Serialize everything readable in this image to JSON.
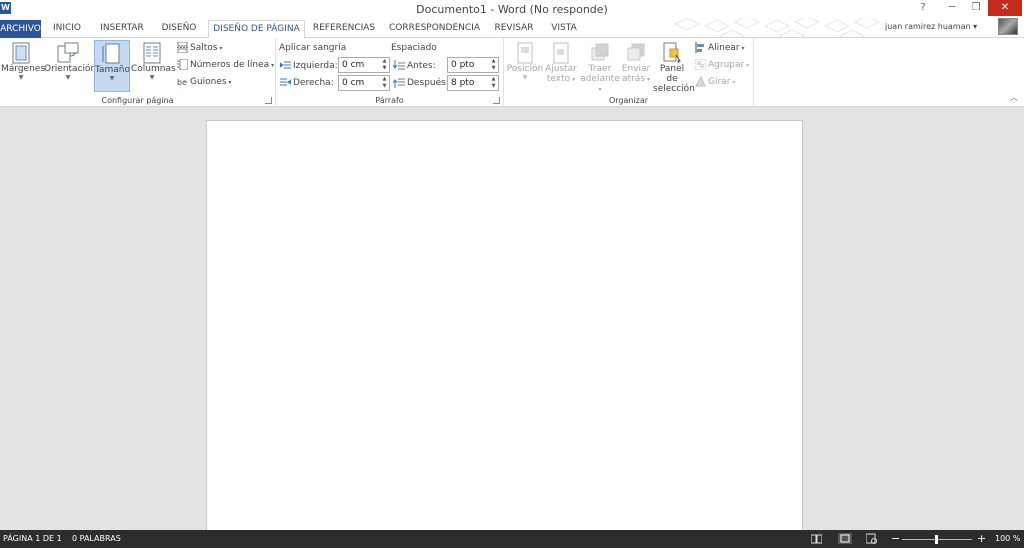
{
  "window": {
    "app_icon": "W",
    "title": "Documento1 - Word (No responde)",
    "help": "?",
    "minimize": "─",
    "restore": "❐",
    "close": "✕"
  },
  "tabs": {
    "file": "ARCHIVO",
    "items": [
      "INICIO",
      "INSERTAR",
      "DISEÑO",
      "DISEÑO DE PÁGINA",
      "REFERENCIAS",
      "CORRESPONDENCIA",
      "REVISAR",
      "VISTA"
    ],
    "active": "DISEÑO DE PÁGINA"
  },
  "user": {
    "name": "juan ramirez huaman",
    "caret": "▾"
  },
  "ribbon": {
    "page_setup": {
      "label": "Configurar página",
      "margins": "Márgenes",
      "orientation": "Orientación",
      "size": "Tamaño",
      "columns": "Columnas",
      "breaks": "Saltos",
      "line_numbers": "Números de línea",
      "hyphenation": "Guiones"
    },
    "paragraph": {
      "label": "Párrafo",
      "indent_header": "Aplicar sangría",
      "spacing_header": "Espaciado",
      "left_label": "Izquierda:",
      "left_value": "0 cm",
      "right_label": "Derecha:",
      "right_value": "0 cm",
      "before_label": "Antes:",
      "before_value": "0 pto",
      "after_label": "Después:",
      "after_value": "8 pto"
    },
    "arrange": {
      "label": "Organizar",
      "position_1": "Posición",
      "wrap_1": "Ajustar",
      "wrap_2": "texto",
      "forward_1": "Traer",
      "forward_2": "adelante",
      "backward_1": "Enviar",
      "backward_2": "atrás",
      "pane_1": "Panel de",
      "pane_2": "selección",
      "align": "Alinear",
      "group": "Agrupar",
      "rotate": "Girar"
    }
  },
  "status": {
    "page": "PÁGINA 1 DE 1",
    "words": "0 PALABRAS",
    "zoom_minus": "−",
    "zoom_plus": "+",
    "zoom": "100 %"
  },
  "colors": {
    "accent": "#2b579a",
    "statusbar": "#2d2d30",
    "close": "#c42b1c",
    "selected": "#c5d9f1"
  }
}
